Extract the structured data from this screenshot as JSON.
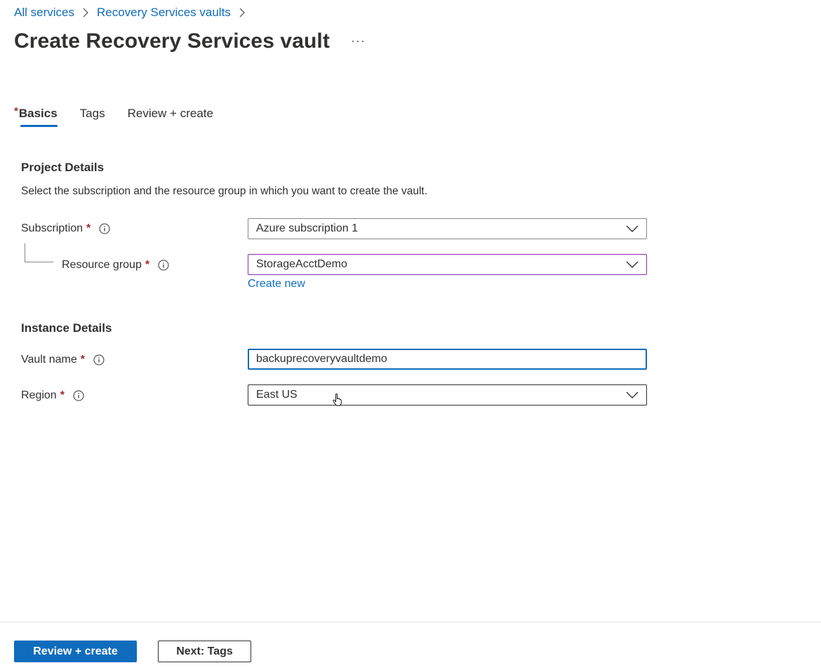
{
  "breadcrumb": {
    "items": [
      {
        "label": "All services"
      },
      {
        "label": "Recovery Services vaults"
      }
    ]
  },
  "header": {
    "title": "Create Recovery Services vault",
    "more_label": "···"
  },
  "tabs": [
    {
      "label": "Basics",
      "required_marker": "*",
      "active": true
    },
    {
      "label": "Tags",
      "active": false
    },
    {
      "label": "Review + create",
      "active": false
    }
  ],
  "project_details": {
    "title": "Project Details",
    "description": "Select the subscription and the resource group in which you want to create the vault.",
    "subscription": {
      "label": "Subscription",
      "required_marker": "*",
      "value": "Azure subscription 1"
    },
    "resource_group": {
      "label": "Resource group",
      "required_marker": "*",
      "value": "StorageAcctDemo",
      "create_new_label": "Create new"
    }
  },
  "instance_details": {
    "title": "Instance Details",
    "vault_name": {
      "label": "Vault name",
      "required_marker": "*",
      "value": "backuprecoveryvaultdemo"
    },
    "region": {
      "label": "Region",
      "required_marker": "*",
      "value": "East US"
    }
  },
  "footer": {
    "primary_label": "Review + create",
    "secondary_label": "Next: Tags"
  },
  "colors": {
    "accent": "#0f6cbd",
    "required": "#a4262c",
    "focus_purple": "#8c2bb5"
  },
  "icons": {
    "breadcrumb_separator": "chevron-right-icon",
    "info": "info-icon",
    "dropdown": "chevron-down-icon",
    "cursor": "hand-pointer-cursor"
  }
}
